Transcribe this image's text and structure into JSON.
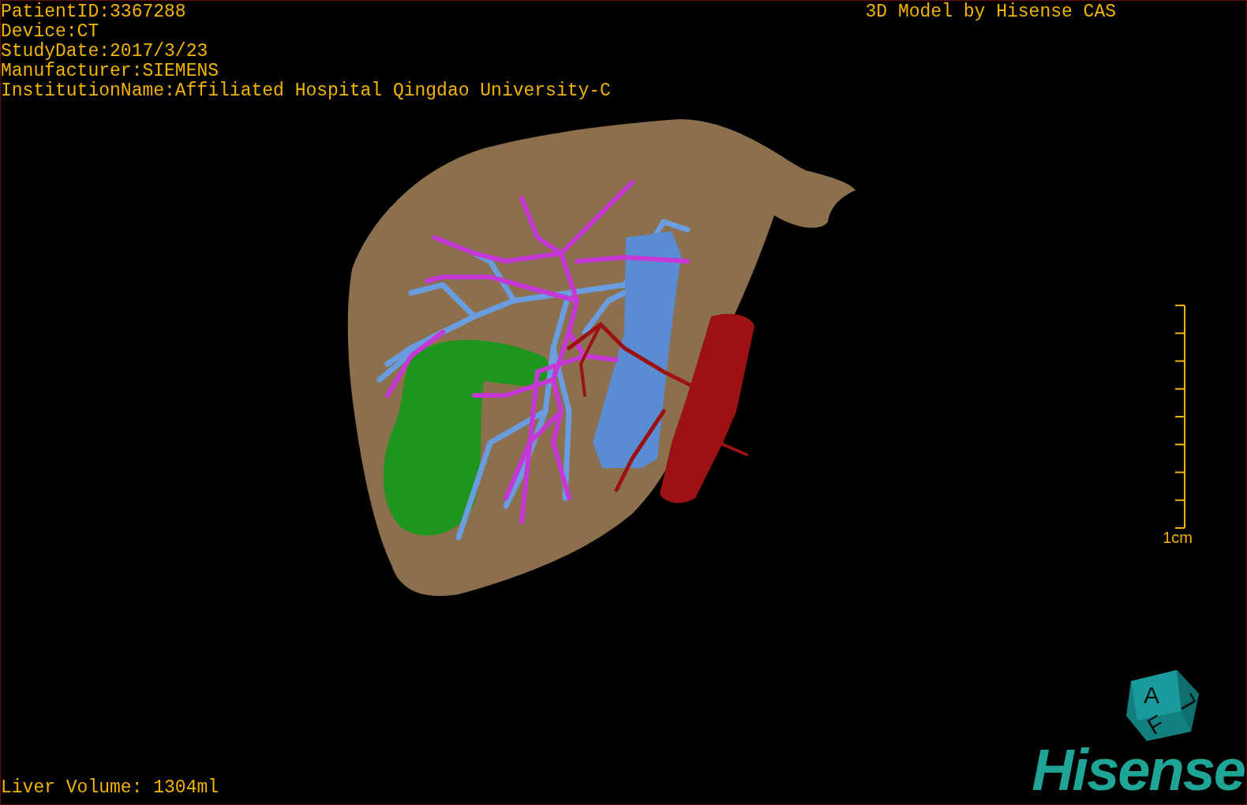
{
  "patient_info": [
    "PatientID:3367288",
    "Device:CT",
    "StudyDate:2017/3/23",
    "Manufacturer:SIEMENS",
    "InstitutionName:Affiliated Hospital Qingdao University-C"
  ],
  "title": "3D Model by Hisense CAS",
  "scale_bar": {
    "label": "1cm"
  },
  "orientation_cube": {
    "faces": [
      "A",
      "F",
      "L"
    ]
  },
  "liver_volume": "Liver Volume: 1304ml",
  "logo": "Hisense"
}
